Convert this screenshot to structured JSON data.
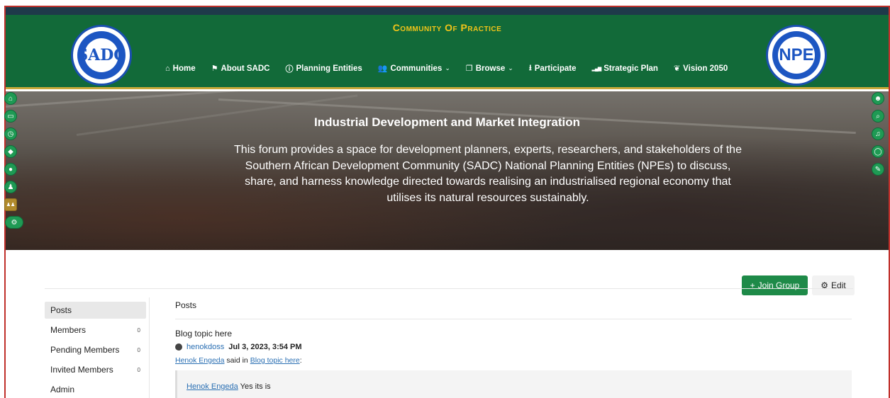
{
  "header": {
    "site_title": "Community Of Practice",
    "logo_left_text": "SADC",
    "logo_right_text": "NPE"
  },
  "nav": [
    {
      "label": "Home",
      "icon": "home-icon",
      "glyph": "⌂",
      "dropdown": false
    },
    {
      "label": "About SADC",
      "icon": "flag-icon",
      "glyph": "⚑",
      "dropdown": false
    },
    {
      "label": "Planning Entities",
      "icon": "info-icon",
      "glyph": "ⓘ",
      "dropdown": false
    },
    {
      "label": "Communities",
      "icon": "users-icon",
      "glyph": "👥",
      "dropdown": true
    },
    {
      "label": "Browse",
      "icon": "window-icon",
      "glyph": "❐",
      "dropdown": true
    },
    {
      "label": "Participate",
      "icon": "download-icon",
      "glyph": "⭳",
      "dropdown": false
    },
    {
      "label": "Strategic Plan",
      "icon": "signal-bars-icon",
      "glyph": "▂▄▆",
      "dropdown": false
    },
    {
      "label": "Vision 2050",
      "icon": "leaf-icon",
      "glyph": "❦",
      "dropdown": false
    }
  ],
  "banner": {
    "title": "Industrial Development and Market Integration",
    "description": "This forum provides a space for development planners, experts, researchers, and stakeholders of the Southern African Development Community (SADC) National Planning Entities (NPEs) to discuss, share, and harness knowledge directed towards realising an industrialised regional economy that utilises its natural resources sustainably."
  },
  "left_rail": [
    {
      "icon": "home-icon",
      "glyph": "⌂"
    },
    {
      "icon": "inbox-icon",
      "glyph": "▭"
    },
    {
      "icon": "clock-icon",
      "glyph": "◷"
    },
    {
      "icon": "tag-icon",
      "glyph": "◆"
    },
    {
      "icon": "fire-icon",
      "glyph": "●"
    },
    {
      "icon": "user-icon",
      "glyph": "♟"
    },
    {
      "icon": "group-icon",
      "glyph": "♟♟"
    },
    {
      "icon": "cogs-icon",
      "glyph": "⚙"
    }
  ],
  "right_rail": [
    {
      "icon": "profile-avatar-icon",
      "glyph": "☻"
    },
    {
      "icon": "search-icon",
      "glyph": "⌕"
    },
    {
      "icon": "bell-icon",
      "glyph": "♫"
    },
    {
      "icon": "chat-icon",
      "glyph": "◯"
    },
    {
      "icon": "compose-icon",
      "glyph": "✎"
    }
  ],
  "actions": {
    "join_label": "Join Group",
    "join_icon": "+",
    "edit_label": "Edit",
    "edit_icon": "⚙"
  },
  "group_menu": [
    {
      "label": "Posts",
      "count": "",
      "active": true
    },
    {
      "label": "Members",
      "count": "0",
      "active": false
    },
    {
      "label": "Pending Members",
      "count": "0",
      "active": false
    },
    {
      "label": "Invited Members",
      "count": "0",
      "active": false
    },
    {
      "label": "Admin",
      "count": "",
      "active": false
    }
  ],
  "posts": {
    "heading": "Posts",
    "items": [
      {
        "title": "Blog topic here",
        "author": "henokdoss",
        "date": "Jul 3, 2023, 3:54 PM",
        "quote_author": "Henok Engeda",
        "quote_said_in": "said in",
        "quote_topic": "Blog topic here",
        "quote_topic_suffix": ":",
        "quote_text_author": "Henok Engeda",
        "quote_text": "Yes its is"
      }
    ]
  },
  "colors": {
    "header_green": "#126a39",
    "title_gold": "#f0c419",
    "accent_green": "#1e8a48",
    "link_blue": "#2a6fb3"
  }
}
